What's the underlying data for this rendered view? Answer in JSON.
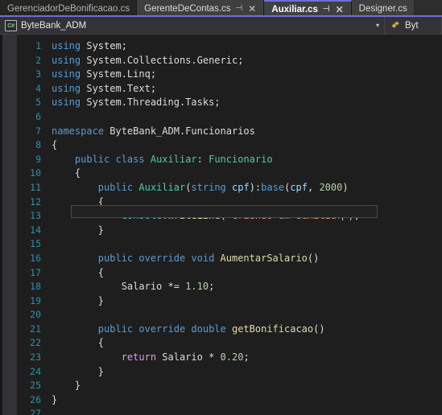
{
  "window": {
    "app": "Visual Studio",
    "theme_bg": "#1e1e1e",
    "accent": "#6f6fd6"
  },
  "tabs": {
    "items": [
      {
        "label": "GerenciadorDeBonificacao.cs",
        "active": false,
        "pinnable": false,
        "closable": false,
        "state": "dim"
      },
      {
        "label": "GerenteDeContas.cs",
        "active": false,
        "pinnable": true,
        "closable": true,
        "state": "other"
      },
      {
        "label": "Auxiliar.cs",
        "active": true,
        "pinnable": true,
        "closable": true,
        "state": "active"
      },
      {
        "label": "Designer.cs",
        "active": false,
        "pinnable": false,
        "closable": false,
        "state": "last"
      }
    ],
    "pin_glyph": "⊣",
    "close_glyph": "✕"
  },
  "navbar": {
    "project_icon": "csharp-icon",
    "project_icon_text": "C#",
    "project": "ByteBank_ADM",
    "caret_glyph": "▾",
    "member_icon": "member-icon",
    "member": "Byt"
  },
  "editor": {
    "current_line": 13,
    "cursor_column": 49,
    "lines": [
      {
        "num": "1",
        "tokens": [
          {
            "t": "k",
            "v": "using"
          },
          {
            "t": "id",
            "v": " System;"
          }
        ]
      },
      {
        "num": "2",
        "tokens": [
          {
            "t": "k",
            "v": "using"
          },
          {
            "t": "id",
            "v": " System.Collections.Generic;"
          }
        ]
      },
      {
        "num": "3",
        "tokens": [
          {
            "t": "k",
            "v": "using"
          },
          {
            "t": "id",
            "v": " System.Linq;"
          }
        ]
      },
      {
        "num": "4",
        "tokens": [
          {
            "t": "k",
            "v": "using"
          },
          {
            "t": "id",
            "v": " System.Text;"
          }
        ]
      },
      {
        "num": "5",
        "tokens": [
          {
            "t": "k",
            "v": "using"
          },
          {
            "t": "id",
            "v": " System.Threading.Tasks;"
          }
        ]
      },
      {
        "num": "6",
        "tokens": []
      },
      {
        "num": "7",
        "tokens": [
          {
            "t": "k",
            "v": "namespace"
          },
          {
            "t": "id",
            "v": " ByteBank_ADM.Funcionarios"
          }
        ]
      },
      {
        "num": "8",
        "tokens": [
          {
            "t": "pu",
            "v": "{"
          }
        ]
      },
      {
        "num": "9",
        "tokens": [
          {
            "t": "pu",
            "v": "    "
          },
          {
            "t": "k",
            "v": "public class"
          },
          {
            "t": "id",
            "v": " "
          },
          {
            "t": "t",
            "v": "Auxiliar"
          },
          {
            "t": "pu",
            "v": ": "
          },
          {
            "t": "t",
            "v": "Funcionario"
          }
        ]
      },
      {
        "num": "10",
        "tokens": [
          {
            "t": "pu",
            "v": "    {"
          }
        ]
      },
      {
        "num": "11",
        "tokens": [
          {
            "t": "pu",
            "v": "        "
          },
          {
            "t": "k",
            "v": "public"
          },
          {
            "t": "id",
            "v": " "
          },
          {
            "t": "t",
            "v": "Auxiliar"
          },
          {
            "t": "pu",
            "v": "("
          },
          {
            "t": "k",
            "v": "string"
          },
          {
            "t": "id",
            "v": " "
          },
          {
            "t": "p",
            "v": "cpf"
          },
          {
            "t": "pu",
            "v": "):"
          },
          {
            "t": "k",
            "v": "base"
          },
          {
            "t": "pu",
            "v": "("
          },
          {
            "t": "p",
            "v": "cpf"
          },
          {
            "t": "pu",
            "v": ", "
          },
          {
            "t": "n",
            "v": "2000"
          },
          {
            "t": "pu",
            "v": ")"
          }
        ]
      },
      {
        "num": "12",
        "tokens": [
          {
            "t": "pu",
            "v": "        {"
          }
        ]
      },
      {
        "num": "13",
        "tokens": [
          {
            "t": "pu",
            "v": "            "
          },
          {
            "t": "t",
            "v": "Console"
          },
          {
            "t": "pu",
            "v": "."
          },
          {
            "t": "m",
            "v": "WriteLine"
          },
          {
            "t": "pu",
            "v": "("
          },
          {
            "t": "s",
            "v": "\"criando um auxiliar"
          },
          {
            "t": "caret",
            "v": ""
          },
          {
            "t": "s",
            "v": "\""
          },
          {
            "t": "pu",
            "v": ");"
          }
        ]
      },
      {
        "num": "14",
        "tokens": [
          {
            "t": "pu",
            "v": "        }"
          }
        ]
      },
      {
        "num": "15",
        "tokens": []
      },
      {
        "num": "16",
        "tokens": [
          {
            "t": "pu",
            "v": "        "
          },
          {
            "t": "k",
            "v": "public override void"
          },
          {
            "t": "id",
            "v": " "
          },
          {
            "t": "m",
            "v": "AumentarSalario"
          },
          {
            "t": "pu",
            "v": "()"
          }
        ]
      },
      {
        "num": "17",
        "tokens": [
          {
            "t": "pu",
            "v": "        {"
          }
        ]
      },
      {
        "num": "18",
        "tokens": [
          {
            "t": "pu",
            "v": "            "
          },
          {
            "t": "id",
            "v": "Salario"
          },
          {
            "t": "pu",
            "v": " *= "
          },
          {
            "t": "n",
            "v": "1.10"
          },
          {
            "t": "pu",
            "v": ";"
          }
        ]
      },
      {
        "num": "19",
        "tokens": [
          {
            "t": "pu",
            "v": "        }"
          }
        ]
      },
      {
        "num": "20",
        "tokens": []
      },
      {
        "num": "21",
        "tokens": [
          {
            "t": "pu",
            "v": "        "
          },
          {
            "t": "k",
            "v": "public override double"
          },
          {
            "t": "id",
            "v": " "
          },
          {
            "t": "m",
            "v": "getBonificacao"
          },
          {
            "t": "pu",
            "v": "()"
          }
        ]
      },
      {
        "num": "22",
        "tokens": [
          {
            "t": "pu",
            "v": "        {"
          }
        ]
      },
      {
        "num": "23",
        "tokens": [
          {
            "t": "pu",
            "v": "            "
          },
          {
            "t": "kc",
            "v": "return"
          },
          {
            "t": "id",
            "v": " Salario"
          },
          {
            "t": "pu",
            "v": " * "
          },
          {
            "t": "n",
            "v": "0.20"
          },
          {
            "t": "pu",
            "v": ";"
          }
        ]
      },
      {
        "num": "24",
        "tokens": [
          {
            "t": "pu",
            "v": "        }"
          }
        ]
      },
      {
        "num": "25",
        "tokens": [
          {
            "t": "pu",
            "v": "    }"
          }
        ]
      },
      {
        "num": "26",
        "tokens": [
          {
            "t": "pu",
            "v": "}"
          }
        ]
      },
      {
        "num": "27",
        "tokens": []
      }
    ]
  },
  "colors": {
    "keyword": "#569cd6",
    "control_keyword": "#d8a0df",
    "type": "#4ec9b0",
    "method": "#dcdcaa",
    "parameter": "#9cdcfe",
    "string": "#d69d85",
    "number": "#b5cea8",
    "identifier": "#dcdcdc",
    "line_number": "#2b91af",
    "editor_background": "#1e1e1e",
    "tab_active_border": "#6f6fd6"
  }
}
